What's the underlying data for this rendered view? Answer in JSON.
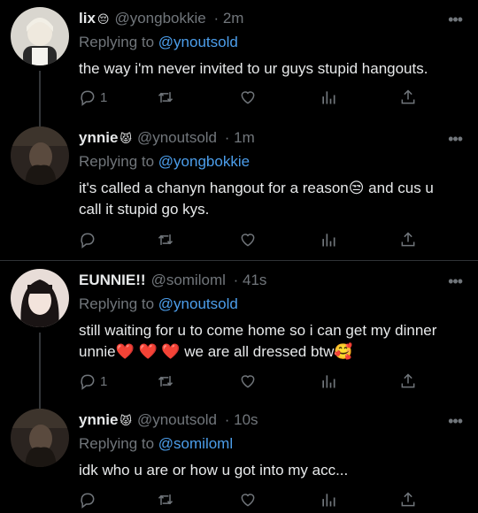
{
  "tweets": [
    {
      "name": "lix",
      "emoji": "😔",
      "handle": "@yongbokkie",
      "time": "· 2m",
      "reply_prefix": "Replying to",
      "reply_to": "@ynoutsold",
      "body_lines": [
        "the way i'm never invited to ur guys stupid hangouts."
      ],
      "reply_count": "1",
      "avatar_colors": [
        "#d9d6cf",
        "#2a2a2a"
      ]
    },
    {
      "name": "ynnie",
      "emoji": "😾",
      "handle": "@ynoutsold",
      "time": "· 1m",
      "reply_prefix": "Replying to",
      "reply_to": "@yongbokkie",
      "body_lines": [
        "it's called a chanyn hangout for a reason😒  and cus u",
        "call it stupid go kys."
      ],
      "reply_count": "",
      "avatar_colors": [
        "#2b2420",
        "#5a4a3e"
      ]
    },
    {
      "name": "EUNNIE!!",
      "emoji": "",
      "handle": "@somiloml",
      "time": "· 41s",
      "reply_prefix": "Replying to",
      "reply_to": "@ynoutsold",
      "body_lines": [
        "still waiting for u to come home so i can get my dinner",
        "unnie❤️ ❤️ ❤️  we are all dressed btw🥰"
      ],
      "reply_count": "1",
      "avatar_colors": [
        "#e8ddd8",
        "#1a1414"
      ]
    },
    {
      "name": "ynnie",
      "emoji": "😾",
      "handle": "@ynoutsold",
      "time": "· 10s",
      "reply_prefix": "Replying to",
      "reply_to": "@somiloml",
      "body_lines": [
        "idk who u are or how u got into my acc..."
      ],
      "reply_count": "",
      "avatar_colors": [
        "#2b2420",
        "#5a4a3e"
      ]
    }
  ],
  "icons": {
    "reply": "reply-icon",
    "retweet": "retweet-icon",
    "like": "heart-icon",
    "views": "views-icon",
    "share": "share-icon",
    "more": "more-icon"
  },
  "colors": {
    "background": "#000000",
    "text": "#e7e9ea",
    "muted": "#71767b",
    "mention": "#4c9eeb"
  }
}
